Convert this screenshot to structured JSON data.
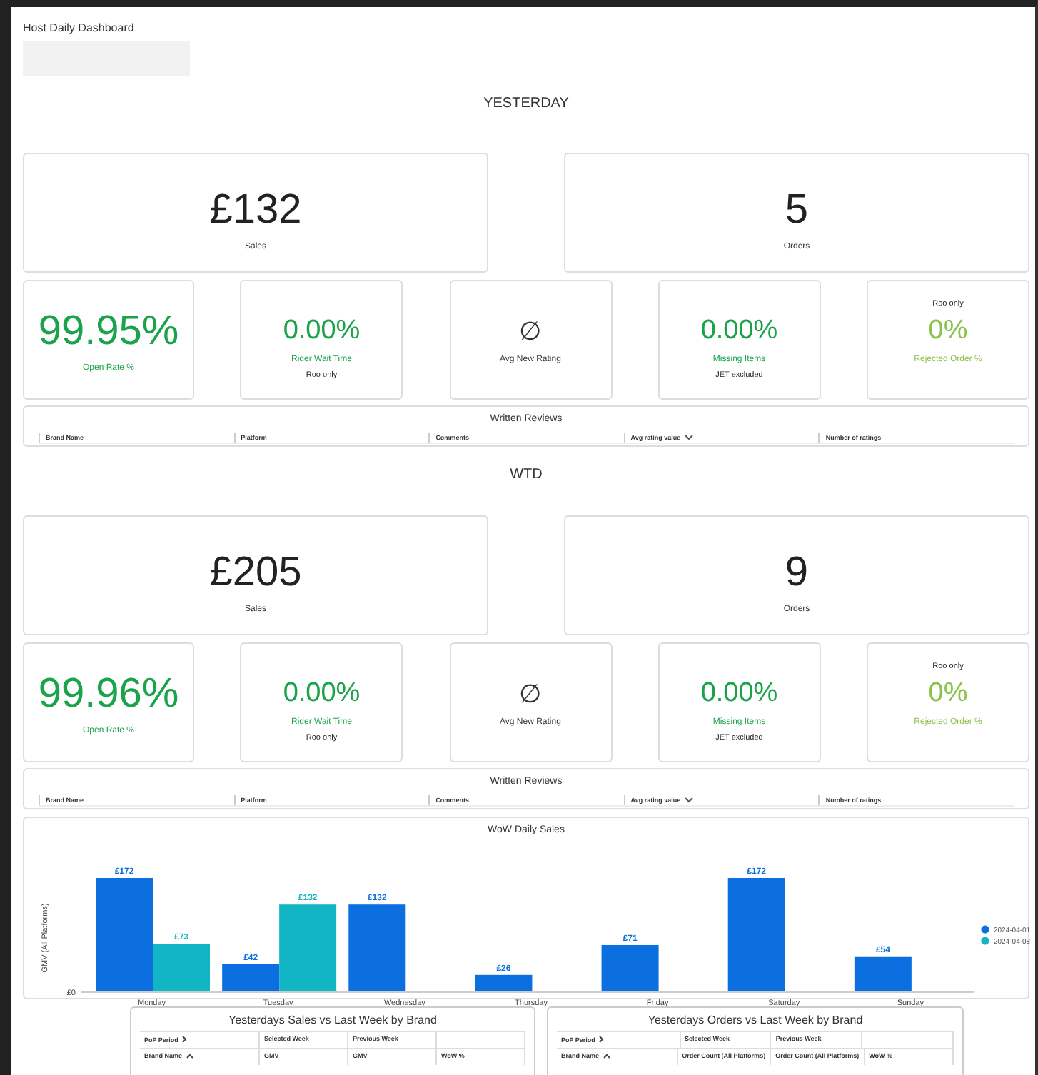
{
  "header": {
    "title": "Host Daily Dashboard"
  },
  "sections": [
    {
      "heading": "YESTERDAY",
      "big_cards": [
        {
          "value": "£132",
          "label": "Sales"
        },
        {
          "value": "5",
          "label": "Orders"
        }
      ],
      "small_cards": [
        {
          "kind": "large_metric",
          "value": "99.95%",
          "label": "Open Rate %",
          "color": "#1aa34a"
        },
        {
          "kind": "metric",
          "value": "0.00%",
          "label": "Rider Wait Time",
          "note": "Roo only",
          "color": "#1aa34a"
        },
        {
          "kind": "empty",
          "value": "∅",
          "label": "Avg New Rating"
        },
        {
          "kind": "metric",
          "value": "0.00%",
          "label": "Missing Items",
          "note": "JET excluded",
          "color": "#1aa34a"
        },
        {
          "kind": "metric",
          "top_note": "Roo only",
          "value": "0%",
          "label": "Rejected Order %",
          "color": "#8bc34a"
        }
      ],
      "reviews": {
        "title": "Written Reviews",
        "columns": [
          {
            "label": "Brand Name"
          },
          {
            "label": "Platform"
          },
          {
            "label": "Comments"
          },
          {
            "label": "Avg rating value",
            "sorted_descending": true
          },
          {
            "label": "Number of ratings"
          }
        ]
      }
    },
    {
      "heading": "WTD",
      "big_cards": [
        {
          "value": "£205",
          "label": "Sales"
        },
        {
          "value": "9",
          "label": "Orders"
        }
      ],
      "small_cards": [
        {
          "kind": "large_metric",
          "value": "99.96%",
          "label": "Open Rate %",
          "color": "#1aa34a"
        },
        {
          "kind": "metric",
          "value": "0.00%",
          "label": "Rider Wait Time",
          "note": "Roo only",
          "color": "#1aa34a"
        },
        {
          "kind": "empty",
          "value": "∅",
          "label": "Avg New Rating"
        },
        {
          "kind": "metric",
          "value": "0.00%",
          "label": "Missing Items",
          "note": "JET excluded",
          "color": "#1aa34a"
        },
        {
          "kind": "metric",
          "top_note": "Roo only",
          "value": "0%",
          "label": "Rejected Order %",
          "color": "#8bc34a"
        }
      ],
      "reviews": {
        "title": "Written Reviews",
        "columns": [
          {
            "label": "Brand Name"
          },
          {
            "label": "Platform"
          },
          {
            "label": "Comments"
          },
          {
            "label": "Avg rating value",
            "sorted_descending": true
          },
          {
            "label": "Number of ratings"
          }
        ]
      }
    }
  ],
  "chart": {
    "chart_data": {
      "type": "bar",
      "title": "WoW Daily Sales",
      "ylabel": "GMV (All Platforms)",
      "categories": [
        "Monday",
        "Tuesday",
        "Wednesday",
        "Thursday",
        "Friday",
        "Saturday",
        "Sunday"
      ],
      "series": [
        {
          "name": "2024-04-01",
          "color": "#0b6fe0",
          "values": [
            172,
            42,
            132,
            26,
            71,
            172,
            54
          ],
          "value_labels": [
            "£172",
            "£42",
            "£132",
            "£26",
            "£71",
            "£172",
            "£54"
          ]
        },
        {
          "name": "2024-04-08",
          "color": "#12b5c4",
          "values": [
            73,
            132,
            null,
            null,
            null,
            null,
            null
          ],
          "value_labels": [
            "£73",
            "£132",
            null,
            null,
            null,
            null,
            null
          ]
        }
      ],
      "annotations": [
        "£0"
      ],
      "legend": "right"
    }
  },
  "tables": [
    {
      "title": "Yesterdays Sales vs Last Week by Brand",
      "header_rows": [
        [
          {
            "label": "PoP Period",
            "expand": true
          },
          {
            "label": "Selected Week"
          },
          {
            "label": "Previous Week"
          },
          {}
        ],
        [
          {
            "label": "Brand Name",
            "sorted_ascending": true
          },
          {
            "label": "GMV"
          },
          {
            "label": "GMV"
          },
          {
            "label": "WoW %"
          }
        ]
      ]
    },
    {
      "title": "Yesterdays Orders vs Last Week by Brand",
      "header_rows": [
        [
          {
            "label": "PoP Period",
            "expand": true
          },
          {
            "label": "Selected Week"
          },
          {
            "label": "Previous Week"
          },
          {}
        ],
        [
          {
            "label": "Brand Name",
            "sorted_ascending": true
          },
          {
            "label": "Order Count (All Platforms)"
          },
          {
            "label": "Order Count (All Platforms)"
          },
          {
            "label": "WoW %"
          }
        ]
      ]
    }
  ]
}
